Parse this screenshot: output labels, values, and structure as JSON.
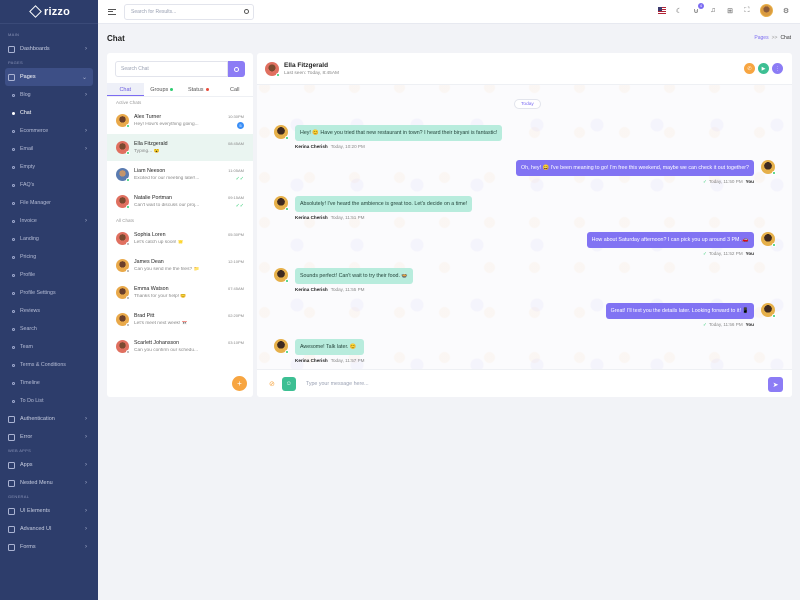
{
  "brand": {
    "name": "rizzo"
  },
  "header": {
    "search_placeholder": "Search for Results...",
    "cart_count": "4"
  },
  "page": {
    "title": "Chat",
    "breadcrumb": [
      "Pages",
      "Chat"
    ]
  },
  "sidebar": {
    "sections": {
      "main": "MAIN",
      "pages": "PAGES",
      "web_apps": "WEB APPS",
      "general": "GENERAL"
    },
    "items": [
      {
        "label": "Dashboards"
      },
      {
        "label": "Pages"
      },
      {
        "label": "Blog"
      },
      {
        "label": "Chat"
      },
      {
        "label": "Ecommerce"
      },
      {
        "label": "Email"
      },
      {
        "label": "Empty"
      },
      {
        "label": "FAQ's"
      },
      {
        "label": "File Manager"
      },
      {
        "label": "Invoice"
      },
      {
        "label": "Landing"
      },
      {
        "label": "Pricing"
      },
      {
        "label": "Profile"
      },
      {
        "label": "Profile Settings"
      },
      {
        "label": "Reviews"
      },
      {
        "label": "Search"
      },
      {
        "label": "Team"
      },
      {
        "label": "Terms & Conditions"
      },
      {
        "label": "Timeline"
      },
      {
        "label": "To Do List"
      },
      {
        "label": "Authentication"
      },
      {
        "label": "Error"
      },
      {
        "label": "Apps"
      },
      {
        "label": "Nested Menu"
      },
      {
        "label": "UI Elements"
      },
      {
        "label": "Advanced UI"
      },
      {
        "label": "Forms"
      }
    ]
  },
  "chat_list": {
    "search_placeholder": "Search Chat",
    "tabs": [
      "Chat",
      "Groups",
      "Status",
      "Call"
    ],
    "active_label": "Active Chats",
    "all_label": "All Chats",
    "active": [
      {
        "name": "Alex Turner",
        "message": "Hey! How's everything going...",
        "time": "10:30PM",
        "unread": "5",
        "status": "online"
      },
      {
        "name": "Ella Fitzgerald",
        "message": "Typing... 😮",
        "time": "08:45AM",
        "status": "online"
      },
      {
        "name": "Liam Neeson",
        "message": "Excited for our meeting later!...",
        "time": "11:05AM",
        "status": "online",
        "read": "✓✓"
      },
      {
        "name": "Natalie Portman",
        "message": "Can't wait to discuss our proj...",
        "time": "09:15AM",
        "status": "online",
        "read": "✓✓"
      }
    ],
    "all": [
      {
        "name": "Sophia Loren",
        "message": "Let's catch up soon! 🌟",
        "time": "05:30PM",
        "status": "offline"
      },
      {
        "name": "James Dean",
        "message": "Can you send me the files? 📁",
        "time": "12:10PM",
        "status": "offline"
      },
      {
        "name": "Emma Watson",
        "message": "Thanks for your help! 😊",
        "time": "07:45AM",
        "status": "offline"
      },
      {
        "name": "Brad Pitt",
        "message": "Let's meet next week! 📅",
        "time": "02:20PM",
        "status": "offline"
      },
      {
        "name": "Scarlett Johansson",
        "message": "Can you confirm our schedu...",
        "time": "03:10PM",
        "status": "offline"
      }
    ]
  },
  "conversation": {
    "contact_name": "Ella Fitzgerald",
    "last_seen": "Last seen: Today, 8:45AM",
    "day": "Today",
    "input_placeholder": "Type your message here...",
    "messages": [
      {
        "side": "left",
        "text": "Hey! 😊 Have you tried that new restaurant in town? I heard their biryani is fantastic!",
        "sender": "Kerina Cherish",
        "time": "Today, 10:20 PM"
      },
      {
        "side": "right",
        "text": "Oh, hey! 😄 I've been meaning to go! I'm free this weekend, maybe we can check it out together?",
        "sender": "You",
        "time": "Today, 11:50 PM"
      },
      {
        "side": "left",
        "text": "Absolutely! I've heard the ambience is great too. Let's decide on a time!",
        "sender": "Kerina Cherish",
        "time": "Today, 11:51 PM"
      },
      {
        "side": "right",
        "text": "How about Saturday afternoon? I can pick you up around 3 PM. 🚗",
        "sender": "You",
        "time": "Today, 11:52 PM"
      },
      {
        "side": "left",
        "text": "Sounds perfect! Can't wait to try their food. 🍲",
        "sender": "Kerina Cherish",
        "time": "Today, 11:55 PM"
      },
      {
        "side": "right",
        "text": "Great! I'll text you the details later. Looking forward to it! 📱",
        "sender": "You",
        "time": "Today, 11:56 PM"
      },
      {
        "side": "left",
        "text": "Awesome! Talk later. 😊",
        "sender": "Kerina Cherish",
        "time": "Today, 11:57 PM"
      }
    ]
  },
  "colors": {
    "sidebar": "#2d3d6b",
    "accent": "#7c6cf2",
    "bubble_left": "#b8ecdd",
    "bubble_right": "#8173f3",
    "online": "#2ecc71"
  }
}
